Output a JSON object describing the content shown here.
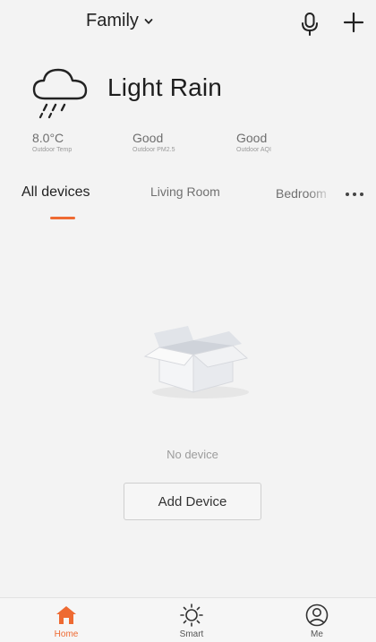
{
  "header": {
    "home_name": "Family",
    "icons": {
      "home_dropdown": "chevron-down-icon",
      "voice": "microphone-icon",
      "add": "plus-icon"
    }
  },
  "weather": {
    "condition": "Light Rain",
    "icon": "cloud-rain-icon",
    "stats": [
      {
        "value": "8.0°C",
        "caption": "Outdoor Temp"
      },
      {
        "value": "Good",
        "caption": "Outdoor PM2.5"
      },
      {
        "value": "Good",
        "caption": "Outdoor AQI"
      }
    ]
  },
  "tabs": {
    "items": [
      {
        "label": "All devices",
        "active": true
      },
      {
        "label": "Living Room",
        "active": false
      },
      {
        "label": "Bedroom",
        "active": false
      }
    ],
    "more_icon": "more-horizontal-icon"
  },
  "empty_state": {
    "illustration": "empty-box-icon",
    "message": "No device",
    "button_label": "Add Device"
  },
  "bottom_nav": {
    "items": [
      {
        "label": "Home",
        "icon": "home-icon",
        "active": true
      },
      {
        "label": "Smart",
        "icon": "sun-icon",
        "active": false
      },
      {
        "label": "Me",
        "icon": "user-icon",
        "active": false
      }
    ]
  },
  "colors": {
    "accent": "#ee6a32",
    "background": "#f3f3f3",
    "text_primary": "#222222",
    "text_secondary": "#6e6e6e"
  }
}
